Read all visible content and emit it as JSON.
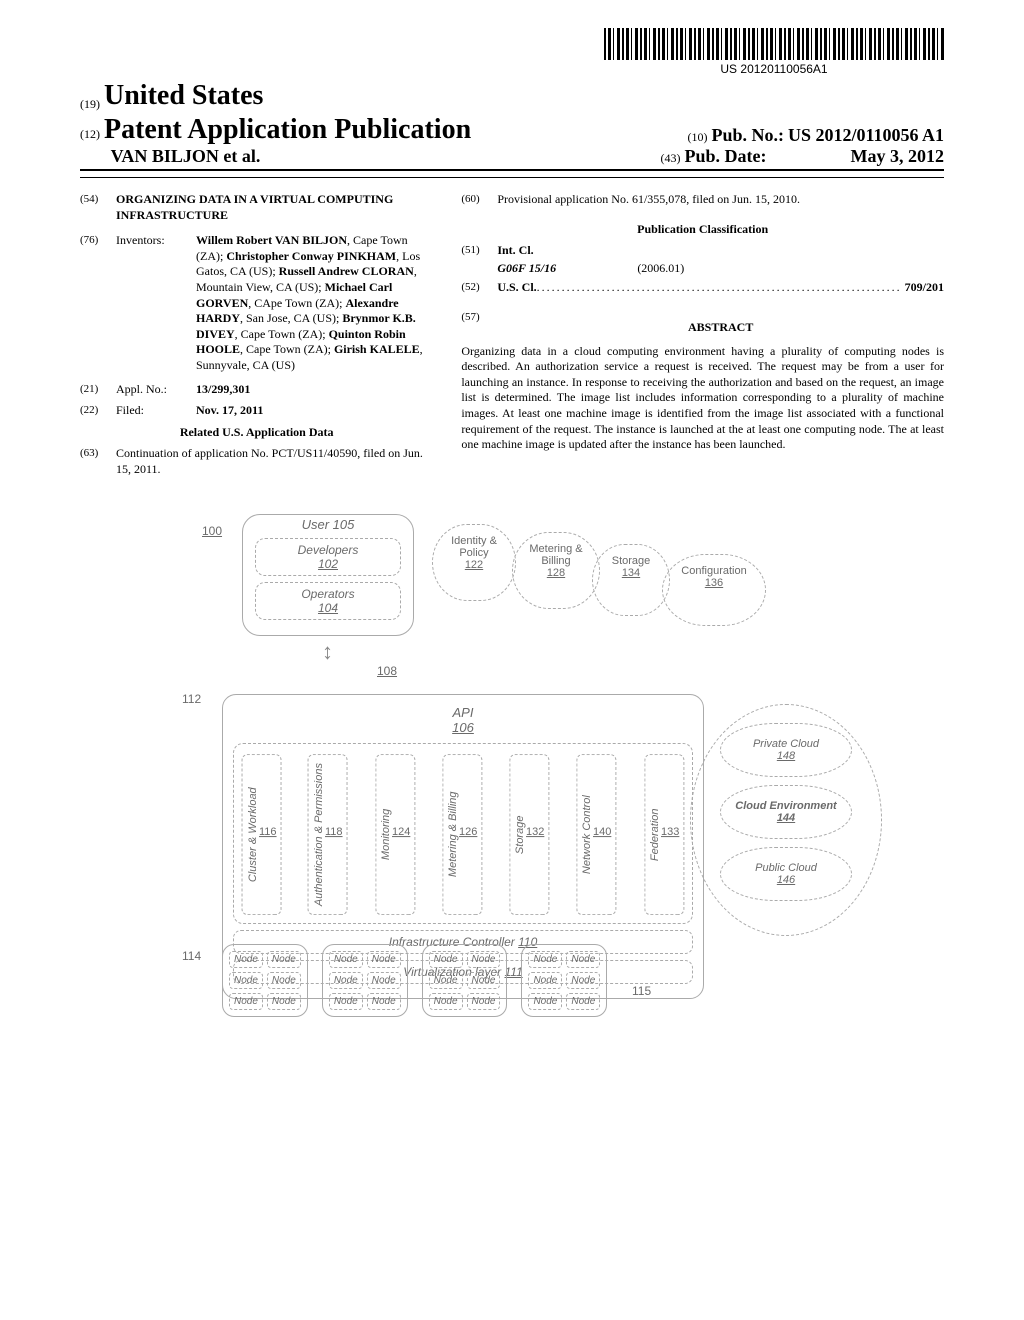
{
  "barcode_text": "US 20120110056A1",
  "header": {
    "tag_19": "(19)",
    "country": "United States",
    "tag_12": "(12)",
    "pub_type": "Patent Application Publication",
    "tag_10": "(10)",
    "pub_no_label": "Pub. No.:",
    "pub_no": "US 2012/0110056 A1",
    "authors": "VAN BILJON et al.",
    "tag_43": "(43)",
    "pub_date_label": "Pub. Date:",
    "pub_date": "May 3, 2012"
  },
  "biblio": {
    "title_tag": "(54)",
    "title": "ORGANIZING DATA IN A VIRTUAL COMPUTING INFRASTRUCTURE",
    "inventors_tag": "(76)",
    "inventors_label": "Inventors:",
    "inventors_html": "Willem Robert VAN BILJON, Cape Town (ZA); Christopher Conway PINKHAM, Los Gatos, CA (US); Russell Andrew CLORAN, Mountain View, CA (US); Michael Carl GORVEN, CApe Town (ZA); Alexandre HARDY, San Jose, CA (US); Brynmor K.B. DIVEY, Cape Town (ZA); Quinton Robin HOOLE, Cape Town (ZA); Girish KALELE, Sunnyvale, CA (US)",
    "appl_tag": "(21)",
    "appl_label": "Appl. No.:",
    "appl_no": "13/299,301",
    "filed_tag": "(22)",
    "filed_label": "Filed:",
    "filed_date": "Nov. 17, 2011",
    "related_title": "Related U.S. Application Data",
    "cont_tag": "(63)",
    "cont_text": "Continuation of application No. PCT/US11/40590, filed on Jun. 15, 2011.",
    "prov_tag": "(60)",
    "prov_text": "Provisional application No. 61/355,078, filed on Jun. 15, 2010."
  },
  "classification": {
    "section_title": "Publication Classification",
    "intcl_tag": "(51)",
    "intcl_label": "Int. Cl.",
    "intcl_code": "G06F 15/16",
    "intcl_date": "(2006.01)",
    "uscl_tag": "(52)",
    "uscl_label": "U.S. Cl.",
    "uscl_code": "709/201"
  },
  "abstract": {
    "tag": "(57)",
    "heading": "ABSTRACT",
    "text": "Organizing data in a cloud computing environment having a plurality of computing nodes is described. An authorization service a request is received. The request may be from a user for launching an instance. In response to receiving the authorization and based on the request, an image list is determined. The image list includes information corresponding to a plurality of machine images. At least one machine image is identified from the image list associated with a functional requirement of the request. The instance is launched at the at least one computing node. The at least one machine image is updated after the instance has been launched."
  },
  "figure": {
    "ref_100": "100",
    "user_title": "User 105",
    "developers": "Developers",
    "developers_ref": "102",
    "operators": "Operators",
    "operators_ref": "104",
    "identity": "Identity & Policy",
    "identity_ref": "122",
    "metering": "Metering & Billing",
    "metering_ref": "128",
    "storage_cloud": "Storage",
    "storage_cloud_ref": "134",
    "config": "Configuration",
    "config_ref": "136",
    "ref_108": "108",
    "ref_112": "112",
    "api_label": "API",
    "api_ref": "106",
    "controllers": [
      {
        "label": "Cluster & Workload",
        "ref": "116"
      },
      {
        "label": "Authentication & Permissions",
        "ref": "118"
      },
      {
        "label": "Monitoring",
        "ref": "124"
      },
      {
        "label": "Metering & Billing",
        "ref": "126"
      },
      {
        "label": "Storage",
        "ref": "132"
      },
      {
        "label": "Network Control",
        "ref": "140"
      },
      {
        "label": "Federation",
        "ref": "133"
      }
    ],
    "infra_label": "Infrastructure Controller",
    "infra_ref": "110",
    "virt_label": "Virtualization layer",
    "virt_ref": "111",
    "ref_114": "114",
    "ref_115": "115",
    "node_label": "Node",
    "node_groups": 4,
    "nodes_per_group": 6,
    "private_cloud": "Private Cloud",
    "private_ref": "148",
    "cloud_env": "Cloud Environment",
    "cloud_env_ref": "144",
    "public_cloud": "Public Cloud",
    "public_ref": "146"
  }
}
